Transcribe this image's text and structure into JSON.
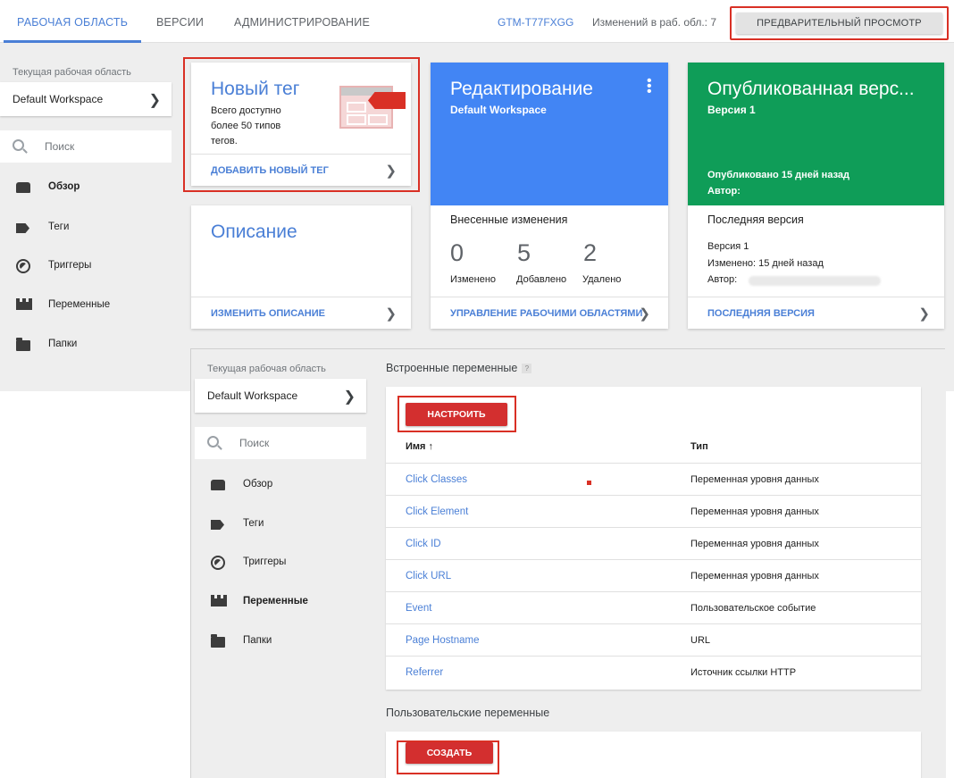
{
  "nav": {
    "tabs": [
      {
        "label": "РАБОЧАЯ ОБЛАСТЬ",
        "active": true
      },
      {
        "label": "ВЕРСИИ",
        "active": false
      },
      {
        "label": "АДМИНИСТРИРОВАНИЕ",
        "active": false
      }
    ],
    "container_id": "GTM-T77FXGG",
    "changes_text": "Изменений в раб. обл.: 7",
    "preview_label": "ПРЕДВАРИТЕЛЬНЫЙ ПРОСМОТР"
  },
  "sidebar": {
    "workspace_label": "Текущая рабочая область",
    "workspace_name": "Default Workspace",
    "search_placeholder": "Поиск",
    "items": [
      {
        "label": "Обзор",
        "icon": "overview-icon"
      },
      {
        "label": "Теги",
        "icon": "tag-icon"
      },
      {
        "label": "Триггеры",
        "icon": "trigger-icon"
      },
      {
        "label": "Переменные",
        "icon": "variables-icon"
      },
      {
        "label": "Папки",
        "icon": "folder-icon"
      }
    ]
  },
  "cards": {
    "new_tag": {
      "title": "Новый тег",
      "body": [
        "Всего доступно",
        "более 50 типов",
        "тегов."
      ],
      "footer": "ДОБАВИТЬ НОВЫЙ ТЕГ"
    },
    "editing": {
      "title": "Редактирование",
      "subtitle": "Default Workspace",
      "changes_title": "Внесенные изменения",
      "stats": [
        {
          "value": "0",
          "label": "Изменено"
        },
        {
          "value": "5",
          "label": "Добавлено"
        },
        {
          "value": "2",
          "label": "Удалено"
        }
      ],
      "footer": "УПРАВЛЕНИЕ РАБОЧИМИ ОБЛАСТЯМИ"
    },
    "published": {
      "title": "Опубликованная верс...",
      "subtitle": "Версия 1",
      "published_ago": "Опубликовано 15 дней назад",
      "author_label": "Автор:",
      "last_version_title": "Последняя версия",
      "version": "Версия 1",
      "modified": "Изменено: 15 дней назад",
      "author": "Автор:",
      "footer": "ПОСЛЕДНЯЯ ВЕРСИЯ"
    },
    "description": {
      "title": "Описание",
      "footer": "ИЗМЕНИТЬ ОПИСАНИЕ"
    }
  },
  "panel": {
    "workspace_label": "Текущая рабочая область",
    "workspace_name": "Default Workspace",
    "search_placeholder": "Поиск",
    "items": [
      {
        "label": "Обзор"
      },
      {
        "label": "Теги"
      },
      {
        "label": "Триггеры"
      },
      {
        "label": "Переменные"
      },
      {
        "label": "Папки"
      }
    ],
    "builtin_title": "Встроенные переменные",
    "configure_label": "НАСТРОИТЬ",
    "col_name": "Имя ↑",
    "col_type": "Тип",
    "rows": [
      {
        "name": "Click Classes",
        "type": "Переменная уровня данных"
      },
      {
        "name": "Click Element",
        "type": "Переменная уровня данных"
      },
      {
        "name": "Click ID",
        "type": "Переменная уровня данных"
      },
      {
        "name": "Click URL",
        "type": "Переменная уровня данных"
      },
      {
        "name": "Event",
        "type": "Пользовательское событие"
      },
      {
        "name": "Page Hostname",
        "type": "URL"
      },
      {
        "name": "Referrer",
        "type": "Источник ссылки HTTP"
      }
    ],
    "user_title": "Пользовательские переменные",
    "create_label": "СОЗДАТЬ"
  },
  "colors": {
    "accent_blue": "#4a7fd6",
    "editing_card": "#4285f4",
    "published_card": "#0f9d58",
    "highlight_red": "#d93025"
  }
}
